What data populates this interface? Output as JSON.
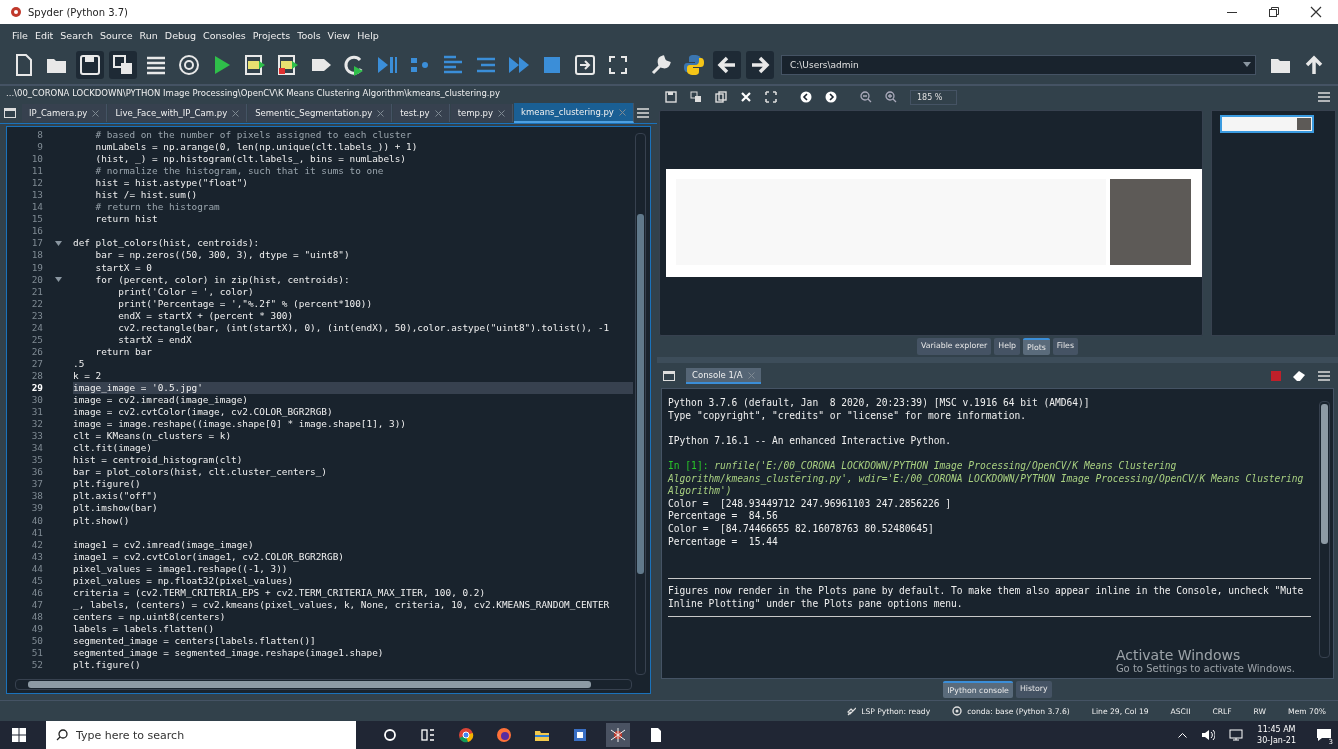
{
  "window": {
    "title": "Spyder (Python 3.7)"
  },
  "menu": [
    "File",
    "Edit",
    "Search",
    "Source",
    "Run",
    "Debug",
    "Consoles",
    "Projects",
    "Tools",
    "View",
    "Help"
  ],
  "toolbar": {
    "working_directory": "C:\\Users\\admin"
  },
  "editor": {
    "path": "...\\00_CORONA LOCKDOWN\\PYTHON Image Processing\\OpenCV\\K Means Clustering Algorithm\\kmeans_clustering.py",
    "tabs": [
      {
        "label": "IP_Camera.py",
        "selected": false
      },
      {
        "label": "Live_Face_with_IP_Cam.py",
        "selected": false
      },
      {
        "label": "Sementic_Segmentation.py",
        "selected": false
      },
      {
        "label": "test.py",
        "selected": false
      },
      {
        "label": "temp.py",
        "selected": false
      },
      {
        "label": "kmeans_clustering.py",
        "selected": true
      }
    ],
    "lines": [
      {
        "number": "8",
        "text": "    # based on the number of pixels assigned to each cluster",
        "kind": "comment",
        "fold": false,
        "current": false
      },
      {
        "number": "9",
        "text": "    numLabels = np.arange(0, len(np.unique(clt.labels_)) + 1)",
        "kind": "code",
        "fold": false,
        "current": false
      },
      {
        "number": "10",
        "text": "    (hist, _) = np.histogram(clt.labels_, bins = numLabels)",
        "kind": "code",
        "fold": false,
        "current": false
      },
      {
        "number": "11",
        "text": "    # normalize the histogram, such that it sums to one",
        "kind": "comment",
        "fold": false,
        "current": false
      },
      {
        "number": "12",
        "text": "    hist = hist.astype(\"float\")",
        "kind": "code",
        "fold": false,
        "current": false
      },
      {
        "number": "13",
        "text": "    hist /= hist.sum()",
        "kind": "code",
        "fold": false,
        "current": false
      },
      {
        "number": "14",
        "text": "    # return the histogram",
        "kind": "comment",
        "fold": false,
        "current": false
      },
      {
        "number": "15",
        "text": "    return hist",
        "kind": "code",
        "fold": false,
        "current": false
      },
      {
        "number": "16",
        "kind": "code",
        "fold": false,
        "current": false
      },
      {
        "number": "17",
        "text": "def plot_colors(hist, centroids):",
        "kind": "code",
        "fold": true,
        "current": false
      },
      {
        "number": "18",
        "text": "    bar = np.zeros((50, 300, 3), dtype = \"uint8\")",
        "kind": "code",
        "fold": false,
        "current": false
      },
      {
        "number": "19",
        "text": "    startX = 0",
        "kind": "code",
        "fold": false,
        "current": false
      },
      {
        "number": "20",
        "text": "    for (percent, color) in zip(hist, centroids):",
        "kind": "code",
        "fold": true,
        "current": false
      },
      {
        "number": "21",
        "text": "        print('Color = ', color)",
        "kind": "code",
        "fold": false,
        "current": false
      },
      {
        "number": "22",
        "text": "        print('Percentage = ',\"%.2f\" % (percent*100))",
        "kind": "code",
        "fold": false,
        "current": false
      },
      {
        "number": "23",
        "text": "        endX = startX + (percent * 300)",
        "kind": "code",
        "fold": false,
        "current": false
      },
      {
        "number": "24",
        "text": "        cv2.rectangle(bar, (int(startX), 0), (int(endX), 50),color.astype(\"uint8\").tolist(), -1",
        "kind": "code",
        "fold": false,
        "current": false
      },
      {
        "number": "25",
        "text": "        startX = endX",
        "kind": "code",
        "fold": false,
        "current": false
      },
      {
        "number": "26",
        "text": "    return bar",
        "kind": "code",
        "fold": false,
        "current": false
      },
      {
        "number": "27",
        "text": ".5",
        "kind": "code",
        "fold": false,
        "current": false
      },
      {
        "number": "28",
        "text": "k = 2",
        "kind": "code",
        "fold": false,
        "current": false
      },
      {
        "number": "29",
        "text": "image_image = '0.5.jpg'",
        "kind": "code",
        "fold": false,
        "current": true
      },
      {
        "number": "30",
        "text": "image = cv2.imread(image_image)",
        "kind": "code",
        "fold": false,
        "current": false
      },
      {
        "number": "31",
        "text": "image = cv2.cvtColor(image, cv2.COLOR_BGR2RGB)",
        "kind": "code",
        "fold": false,
        "current": false
      },
      {
        "number": "32",
        "text": "image = image.reshape((image.shape[0] * image.shape[1], 3))",
        "kind": "code",
        "fold": false,
        "current": false
      },
      {
        "number": "33",
        "text": "clt = KMeans(n_clusters = k)",
        "kind": "code",
        "fold": false,
        "current": false
      },
      {
        "number": "34",
        "text": "clt.fit(image)",
        "kind": "code",
        "fold": false,
        "current": false
      },
      {
        "number": "35",
        "text": "hist = centroid_histogram(clt)",
        "kind": "code",
        "fold": false,
        "current": false
      },
      {
        "number": "36",
        "text": "bar = plot_colors(hist, clt.cluster_centers_)",
        "kind": "code",
        "fold": false,
        "current": false
      },
      {
        "number": "37",
        "text": "plt.figure()",
        "kind": "code",
        "fold": false,
        "current": false
      },
      {
        "number": "38",
        "text": "plt.axis(\"off\")",
        "kind": "code",
        "fold": false,
        "current": false
      },
      {
        "number": "39",
        "text": "plt.imshow(bar)",
        "kind": "code",
        "fold": false,
        "current": false
      },
      {
        "number": "40",
        "text": "plt.show()",
        "kind": "code",
        "fold": false,
        "current": false
      },
      {
        "number": "41",
        "kind": "code",
        "fold": false,
        "current": false
      },
      {
        "number": "42",
        "text": "image1 = cv2.imread(image_image)",
        "kind": "code",
        "fold": false,
        "current": false
      },
      {
        "number": "43",
        "text": "image1 = cv2.cvtColor(image1, cv2.COLOR_BGR2RGB)",
        "kind": "code",
        "fold": false,
        "current": false
      },
      {
        "number": "44",
        "text": "pixel_values = image1.reshape((-1, 3))",
        "kind": "code",
        "fold": false,
        "current": false
      },
      {
        "number": "45",
        "text": "pixel_values = np.float32(pixel_values)",
        "kind": "code",
        "fold": false,
        "current": false
      },
      {
        "number": "46",
        "text": "criteria = (cv2.TERM_CRITERIA_EPS + cv2.TERM_CRITERIA_MAX_ITER, 100, 0.2)",
        "kind": "code",
        "fold": false,
        "current": false
      },
      {
        "number": "47",
        "text": "_, labels, (centers) = cv2.kmeans(pixel_values, k, None, criteria, 10, cv2.KMEANS_RANDOM_CENTER",
        "kind": "code",
        "fold": false,
        "current": false
      },
      {
        "number": "48",
        "text": "centers = np.uint8(centers)",
        "kind": "code",
        "fold": false,
        "current": false
      },
      {
        "number": "49",
        "text": "labels = labels.flatten()",
        "kind": "code",
        "fold": false,
        "current": false
      },
      {
        "number": "50",
        "text": "segmented_image = centers[labels.flatten()]",
        "kind": "code",
        "fold": false,
        "current": false
      },
      {
        "number": "51",
        "text": "segmented_image = segmented_image.reshape(image1.shape)",
        "kind": "code",
        "fold": false,
        "current": false
      },
      {
        "number": "52",
        "text": "plt.figure()",
        "kind": "code",
        "fold": false,
        "current": false
      }
    ]
  },
  "plots": {
    "zoom": "185 %"
  },
  "pane_tabs": [
    {
      "label": "Variable explorer",
      "selected": false
    },
    {
      "label": "Help",
      "selected": false
    },
    {
      "label": "Plots",
      "selected": true
    },
    {
      "label": "Files",
      "selected": false
    }
  ],
  "console": {
    "tabs": [
      {
        "label": "Console 1/A",
        "selected": true
      }
    ],
    "lines": [
      {
        "kind": "output",
        "text": "Python 3.7.6 (default, Jan  8 2020, 20:23:39) [MSC v.1916 64 bit (AMD64)]"
      },
      {
        "kind": "output",
        "text": "Type \"copyright\", \"credits\" or \"license\" for more information."
      },
      {
        "kind": "blank"
      },
      {
        "kind": "output",
        "text": "IPython 7.16.1 -- An enhanced Interactive Python."
      },
      {
        "kind": "blank"
      },
      {
        "kind": "input",
        "prompt": "In [1]:",
        "text": "runfile('E:/00_CORONA LOCKDOWN/PYTHON Image Processing/OpenCV/K Means Clustering Algorithm/kmeans_clustering.py', wdir='E:/00_CORONA LOCKDOWN/PYTHON Image Processing/OpenCV/K Means Clustering Algorithm')"
      },
      {
        "kind": "output",
        "text": "Color =  [248.93449712 247.96961103 247.2856226 ]"
      },
      {
        "kind": "output",
        "text": "Percentage =  84.56"
      },
      {
        "kind": "output",
        "text": "Color =  [84.74466655 82.16078763 80.52480645]"
      },
      {
        "kind": "output",
        "text": "Percentage =  15.44"
      }
    ],
    "notice": "Figures now render in the Plots pane by default. To make them also appear inline in the Console, uncheck \"Mute Inline Plotting\" under the Plots pane options menu."
  },
  "console_tabs": [
    {
      "label": "IPython console",
      "selected": true
    },
    {
      "label": "History",
      "selected": false
    }
  ],
  "activation": {
    "title": "Activate Windows",
    "subtitle": "Go to Settings to activate Windows."
  },
  "status_bar": [
    {
      "kind": "lsp",
      "text": "LSP Python: ready"
    },
    {
      "kind": "conda",
      "text": "conda: base (Python 3.7.6)"
    },
    {
      "kind": "plain",
      "text": "Line 29, Col 19"
    },
    {
      "kind": "plain",
      "text": "ASCII"
    },
    {
      "kind": "plain",
      "text": "CRLF"
    },
    {
      "kind": "plain",
      "text": "RW"
    },
    {
      "kind": "plain",
      "text": "Mem 70%"
    }
  ],
  "taskbar": {
    "search_placeholder": "Type here to search",
    "time": "11:45 AM",
    "date": "30-Jan-21",
    "notifications": "3"
  }
}
